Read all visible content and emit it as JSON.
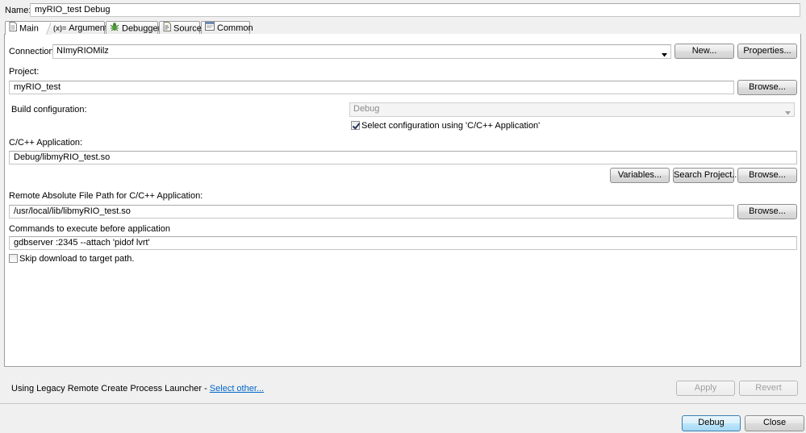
{
  "header": {
    "name_label": "Name:",
    "name_value": "myRIO_test Debug"
  },
  "tabs": [
    {
      "label": "Main",
      "active": true,
      "icon": "main-doc-icon"
    },
    {
      "label": "Arguments",
      "active": false,
      "icon": "arguments-icon"
    },
    {
      "label": "Debugger",
      "active": false,
      "icon": "debugger-bug-icon"
    },
    {
      "label": "Source",
      "active": false,
      "icon": "source-icon"
    },
    {
      "label": "Common",
      "active": false,
      "icon": "common-icon"
    }
  ],
  "main": {
    "connection_label": "Connection:",
    "connection_value": "NImyRIOMilz",
    "new_button": "New...",
    "properties_button": "Properties...",
    "project_label": "Project:",
    "project_value": "myRIO_test",
    "project_browse": "Browse...",
    "build_config_label": "Build configuration:",
    "build_config_value": "Debug",
    "select_config_checkbox": {
      "label": "Select configuration using 'C/C++ Application'",
      "checked": true
    },
    "app_label": "C/C++ Application:",
    "app_value": "Debug/libmyRIO_test.so",
    "variables_button": "Variables...",
    "search_project_button": "Search Project...",
    "app_browse": "Browse...",
    "remote_path_label": "Remote Absolute File Path for C/C++ Application:",
    "remote_path_value": "/usr/local/lib/libmyRIO_test.so",
    "remote_browse": "Browse...",
    "commands_label": "Commands to execute before application",
    "commands_value": "gdbserver :2345 --attach 'pidof lvrt'",
    "skip_download_checkbox": {
      "label": "Skip download to target path.",
      "checked": false
    }
  },
  "footer": {
    "launcher_text": "Using Legacy Remote Create Process Launcher - ",
    "select_other_link": "Select other...",
    "apply_button": "Apply",
    "revert_button": "Revert",
    "debug_button": "Debug",
    "close_button": "Close"
  },
  "colors": {
    "link": "#0066cc",
    "panel_border": "#9d9d9d",
    "default_button": "#3c7fb1"
  }
}
